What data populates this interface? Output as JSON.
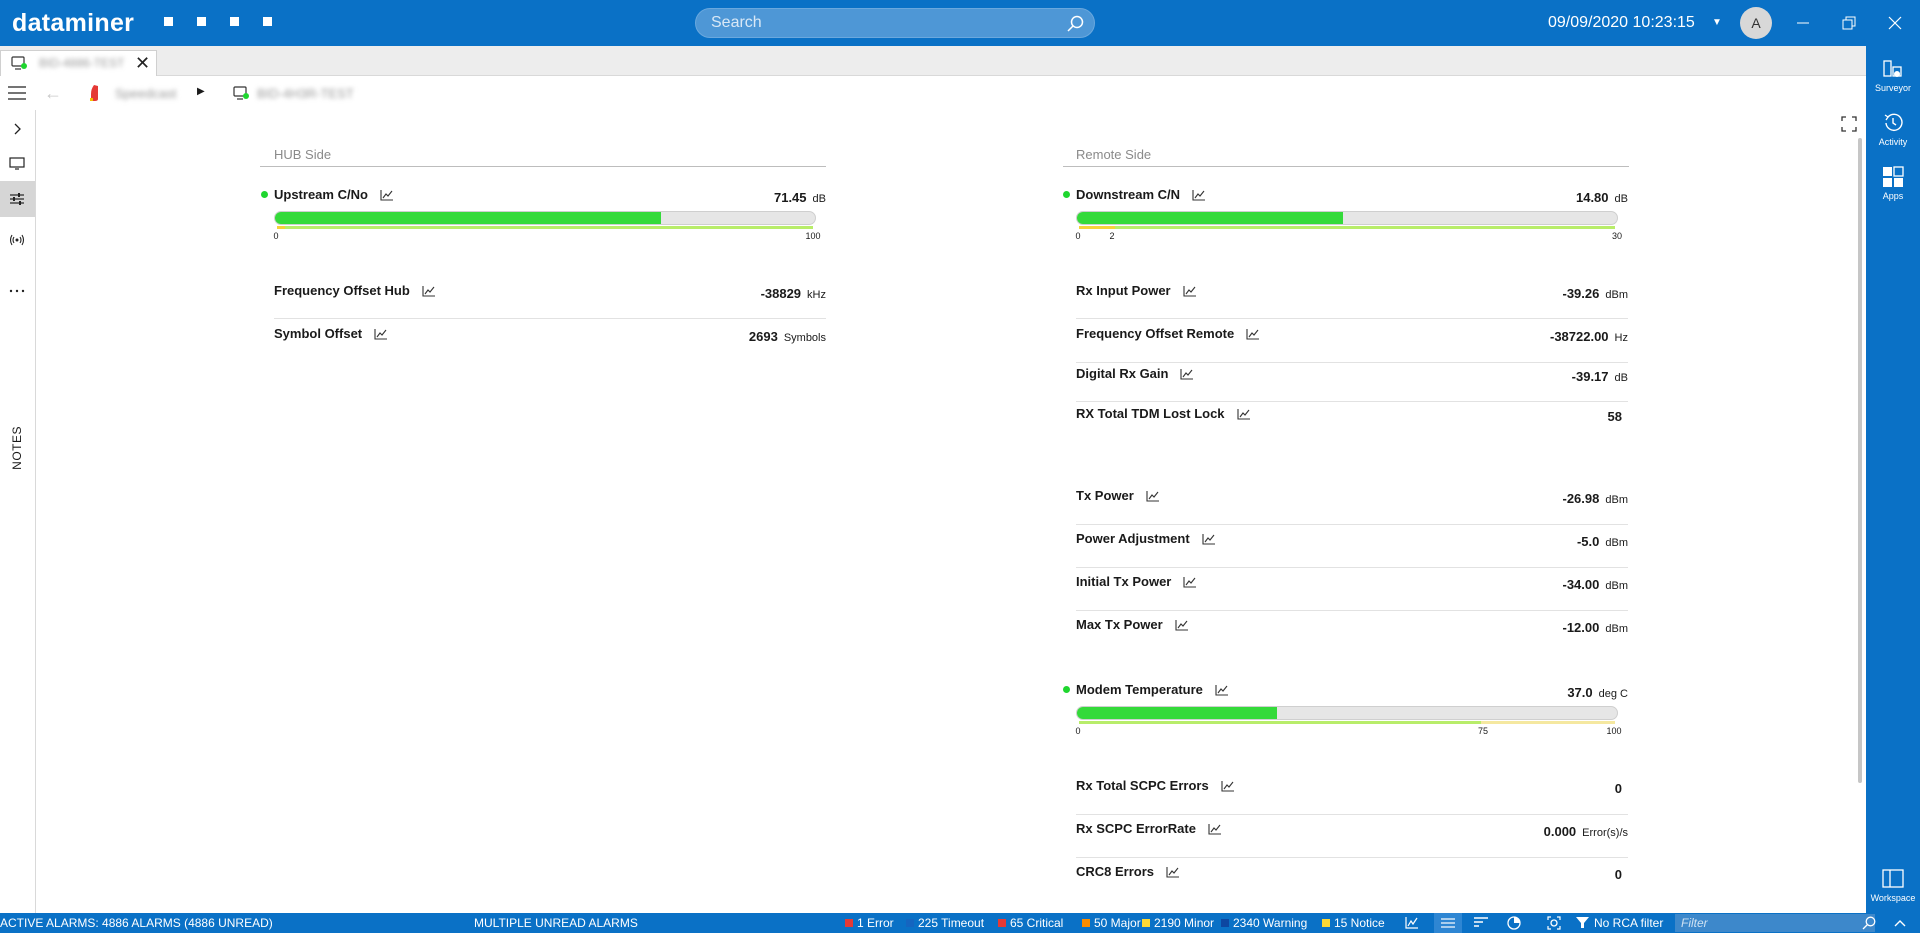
{
  "app": {
    "logo": "dataminer",
    "datetime": "09/09/2020 10:23:15",
    "user_initial": "A"
  },
  "search": {
    "placeholder": "Search"
  },
  "tabs": [
    {
      "label": "BID-4886-TEST"
    }
  ],
  "breadcrumb": {
    "items": [
      {
        "label": "Speedcast"
      },
      {
        "label": "BID-4H3R-TEST"
      }
    ]
  },
  "left_rail": {
    "notes_label": "NOTES"
  },
  "right_rail": {
    "surveyor": "Surveyor",
    "activity": "Activity",
    "apps": "Apps",
    "workspace": "Workspace"
  },
  "hub": {
    "title": "HUB Side",
    "upstream": {
      "label": "Upstream C/No",
      "value": "71.45",
      "unit": "dB",
      "fraction": 0.7145,
      "min_label": "0",
      "max_label": "100"
    },
    "params": [
      {
        "label": "Frequency Offset Hub",
        "value": "-38829",
        "unit": "kHz"
      },
      {
        "label": "Symbol Offset",
        "value": "2693",
        "unit": "Symbols"
      }
    ]
  },
  "remote": {
    "title": "Remote Side",
    "downstream": {
      "label": "Downstream C/N",
      "value": "14.80",
      "unit": "dB",
      "fraction": 0.4933,
      "min_label": "0",
      "mid_label": "2",
      "max_label": "30"
    },
    "params_a": [
      {
        "label": "Rx Input Power",
        "value": "-39.26",
        "unit": "dBm"
      },
      {
        "label": "Frequency Offset Remote",
        "value": "-38722.00",
        "unit": "Hz"
      },
      {
        "label": "Digital Rx Gain",
        "value": "-39.17",
        "unit": "dB"
      },
      {
        "label": "RX Total TDM Lost Lock",
        "value": "58",
        "unit": ""
      }
    ],
    "params_b": [
      {
        "label": "Tx Power",
        "value": "-26.98",
        "unit": "dBm"
      },
      {
        "label": "Power Adjustment",
        "value": "-5.0",
        "unit": "dBm"
      },
      {
        "label": "Initial Tx Power",
        "value": "-34.00",
        "unit": "dBm"
      },
      {
        "label": "Max Tx Power",
        "value": "-12.00",
        "unit": "dBm"
      }
    ],
    "temperature": {
      "label": "Modem Temperature",
      "value": "37.0",
      "unit": "deg C",
      "fraction": 0.37,
      "min_label": "0",
      "mid_label": "75",
      "max_label": "100"
    },
    "params_c": [
      {
        "label": "Rx Total SCPC Errors",
        "value": "0",
        "unit": ""
      },
      {
        "label": "Rx SCPC ErrorRate",
        "value": "0.000",
        "unit": "Error(s)/s"
      },
      {
        "label": "CRC8 Errors",
        "value": "0",
        "unit": ""
      }
    ]
  },
  "status_bar": {
    "active_alarms": "ACTIVE ALARMS: 4886 ALARMS (4886 UNREAD)",
    "unread": "MULTIPLE UNREAD ALARMS",
    "counters": [
      {
        "label": "1 Error",
        "color": "#e53935"
      },
      {
        "label": "225 Timeout",
        "color": "#1565c0"
      },
      {
        "label": "65 Critical",
        "color": "#e53935"
      },
      {
        "label": "50 Major",
        "color": "#fb8c00"
      },
      {
        "label": "2190 Minor",
        "color": "#fdd835"
      },
      {
        "label": "2340 Warning",
        "color": "#0d47a1"
      },
      {
        "label": "15 Notice",
        "color": "#fdd835"
      }
    ],
    "rca_filter": "No RCA filter",
    "filter_placeholder": "Filter"
  },
  "colors": {
    "brand": "#0a71c6",
    "ok": "#34da3a"
  }
}
